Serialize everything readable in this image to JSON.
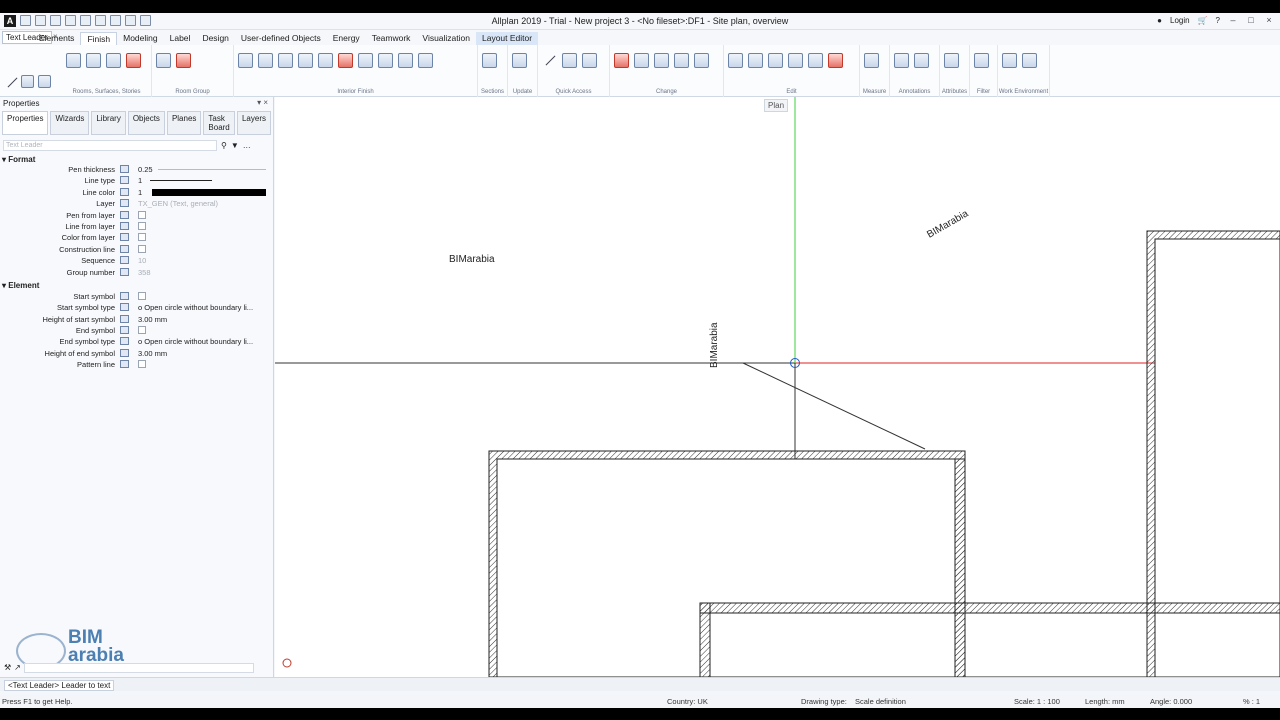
{
  "titlebar": {
    "app_logo": "A",
    "title": "Allplan 2019 - Trial - New project 3 - <No fileset>:DF1 - Site plan, overview",
    "login": "Login"
  },
  "panel_name": "Text Leader",
  "menu_tabs": [
    "Elements",
    "Finish",
    "Modeling",
    "Label",
    "Design",
    "User-defined Objects",
    "Energy",
    "Teamwork",
    "Visualization",
    "Layout Editor"
  ],
  "ribbon_groups": [
    "Rooms, Surfaces, Stories",
    "Room Group",
    "Interior Finish",
    "Sections",
    "Update",
    "Quick Access",
    "Change",
    "Edit",
    "Measure",
    "Annotations",
    "Attributes",
    "Filter",
    "Work Environment"
  ],
  "left_panel": {
    "title": "Properties",
    "tabs": [
      "Properties",
      "Wizards",
      "Library",
      "Objects",
      "Planes",
      "Task Board",
      "Layers"
    ],
    "search_placeholder": "Text Leader",
    "format_section": "Format",
    "element_section": "Element",
    "format_props": [
      {
        "label": "Pen thickness",
        "value": "0.25",
        "grey": false
      },
      {
        "label": "Line type",
        "value": "1",
        "grey": false
      },
      {
        "label": "Line color",
        "value": "1",
        "grey": false
      },
      {
        "label": "Layer",
        "value": "TX_GEN (Text, general)",
        "grey": true
      },
      {
        "label": "Pen from layer",
        "value": "",
        "grey": false
      },
      {
        "label": "Line from layer",
        "value": "",
        "grey": false
      },
      {
        "label": "Color from layer",
        "value": "",
        "grey": false
      },
      {
        "label": "Construction line",
        "value": "",
        "grey": false
      },
      {
        "label": "Sequence",
        "value": "10",
        "grey": true
      },
      {
        "label": "Group number",
        "value": "358",
        "grey": true
      }
    ],
    "element_props": [
      {
        "label": "Start symbol",
        "value": ""
      },
      {
        "label": "Start symbol type",
        "value": "o   Open circle without boundary li..."
      },
      {
        "label": "Height of start symbol",
        "value": "3.00 mm"
      },
      {
        "label": "End symbol",
        "value": ""
      },
      {
        "label": "End symbol type",
        "value": "o   Open circle without boundary li..."
      },
      {
        "label": "Height of end symbol",
        "value": "3.00 mm"
      },
      {
        "label": "Pattern line",
        "value": ""
      }
    ],
    "logo_line1": "BIM",
    "logo_line2": "arabia"
  },
  "canvas": {
    "plan_button": "Plan",
    "labels": [
      "BIMarabia",
      "BIMarabia",
      "BIMarabia"
    ]
  },
  "dialog_line": "<Text Leader> Leader to text",
  "statusbar": {
    "help": "Press F1 to get Help.",
    "country": "Country: UK",
    "drawing_type_label": "Drawing type:",
    "drawing_type": "Scale definition",
    "scale": "Scale: 1 : 100",
    "length": "Length: mm",
    "angle": "Angle: 0.000",
    "pct": "% : 1"
  },
  "colors": {
    "x_axis": "#e02020",
    "y_axis": "#3ccf3c",
    "accent": "#4c7fb2"
  }
}
